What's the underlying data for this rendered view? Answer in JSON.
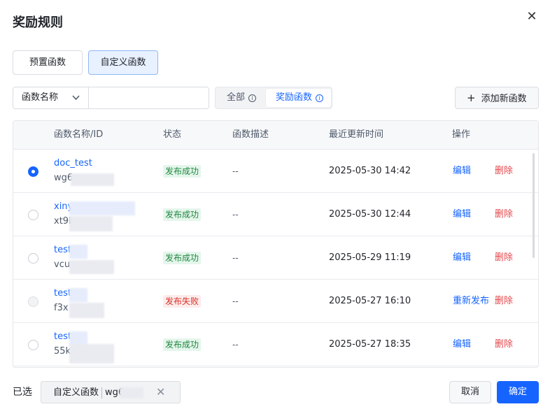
{
  "dialog": {
    "title": "奖励规则",
    "close_icon": "close-icon"
  },
  "type_tabs": [
    {
      "label": "预置函数",
      "active": false
    },
    {
      "label": "自定义函数",
      "active": true
    }
  ],
  "filter": {
    "select_value": "函数名称",
    "input_placeholder": "",
    "segments": [
      {
        "label": "全部",
        "active": false
      },
      {
        "label": "奖励函数",
        "active": true
      }
    ],
    "info_glyph": "i"
  },
  "add_button": {
    "icon": "+",
    "label": "添加新函数"
  },
  "table": {
    "headers": [
      "函数名称/ID",
      "状态",
      "函数描述",
      "最近更新时间",
      "操作"
    ],
    "rows": [
      {
        "selected": true,
        "enabled": true,
        "name": "doc_test",
        "id": "wg6",
        "status": "发布成功",
        "status_type": "success",
        "desc": "--",
        "time": "2025-05-30 14:42",
        "action": "编辑",
        "delete": "删除"
      },
      {
        "selected": false,
        "enabled": true,
        "name": "xiny",
        "id": "xt9i",
        "status": "发布成功",
        "status_type": "success",
        "desc": "--",
        "time": "2025-05-30 12:44",
        "action": "编辑",
        "delete": "删除"
      },
      {
        "selected": false,
        "enabled": true,
        "name": "test",
        "id": "vcu",
        "status": "发布成功",
        "status_type": "success",
        "desc": "--",
        "time": "2025-05-29 11:19",
        "action": "编辑",
        "delete": "删除"
      },
      {
        "selected": false,
        "enabled": false,
        "name": "test",
        "id": "f3x",
        "status": "发布失败",
        "status_type": "failed",
        "desc": "--",
        "time": "2025-05-27 16:10",
        "action": "重新发布",
        "delete": "删除"
      },
      {
        "selected": false,
        "enabled": true,
        "name": "test",
        "id": "55k",
        "status": "发布成功",
        "status_type": "success",
        "desc": "--",
        "time": "2025-05-27 18:35",
        "action": "编辑",
        "delete": "删除"
      }
    ]
  },
  "footer": {
    "selected_label": "已选",
    "chip": {
      "name": "自定义函数",
      "id": "wg6"
    },
    "cancel_label": "取消",
    "confirm_label": "确定"
  },
  "colors": {
    "primary": "#1664ff",
    "success": "#20873f",
    "danger": "#e5484d"
  }
}
